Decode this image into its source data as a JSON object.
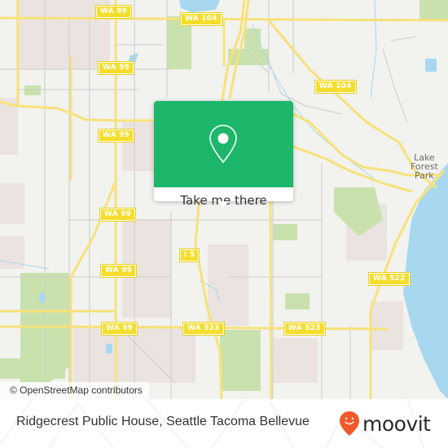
{
  "map": {
    "route_shields": [
      {
        "label": "WA 99",
        "id": "wa99-a"
      },
      {
        "label": "WA 104",
        "id": "wa104-a"
      },
      {
        "label": "WA 99",
        "id": "wa99-b"
      },
      {
        "label": "WA 104",
        "id": "wa104-b"
      },
      {
        "label": "WA 99",
        "id": "wa99-c"
      },
      {
        "label": "WA 99",
        "id": "wa99-d"
      },
      {
        "label": "I 5",
        "id": "i5"
      },
      {
        "label": "WA 99",
        "id": "wa99-e"
      },
      {
        "label": "WA 522",
        "id": "wa522"
      },
      {
        "label": "WA 99",
        "id": "wa99-f"
      },
      {
        "label": "WA 523",
        "id": "wa523-a"
      },
      {
        "label": "WA 523",
        "id": "wa523-b"
      }
    ],
    "place_labels": [
      {
        "lines": [
          "Lake",
          "Forest",
          "Park"
        ]
      }
    ],
    "attribution": "© OpenStreetMap contributors",
    "colors": {
      "land": "#f2f2ef",
      "road_major": "#f7e27a",
      "water": "#a7d8ef",
      "park": "#c9e2ad",
      "urban": "#ebe3df"
    }
  },
  "popup": {
    "icon": "map-pin-icon",
    "button_label": "Take me there",
    "accent_color": "#1cb76a"
  },
  "footer": {
    "place_title": "Ridgecrest Public House, Seattle Tacoma Bellevue",
    "brand": "moovit",
    "brand_color": "#f0592a"
  }
}
